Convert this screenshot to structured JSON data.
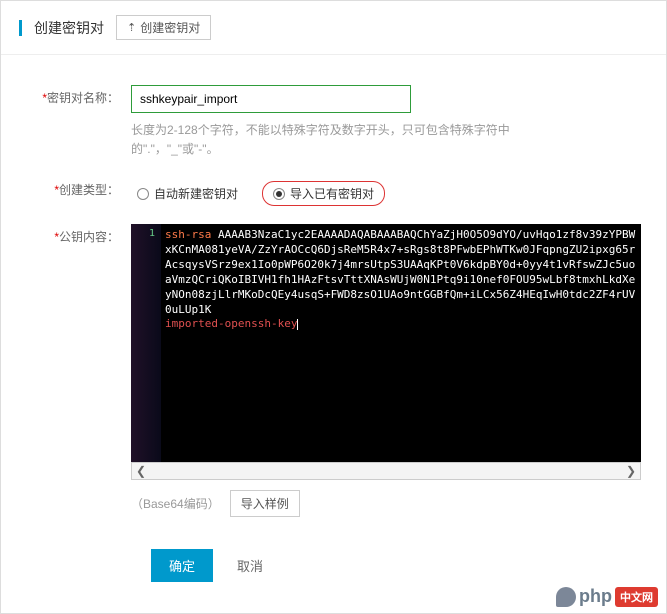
{
  "header": {
    "title": "创建密钥对",
    "upload_btn": "创建密钥对"
  },
  "labels": {
    "name": "密钥对名称：",
    "type": "创建类型：",
    "pubkey": "公钥内容："
  },
  "name_input": {
    "value": "sshkeypair_import",
    "hint": "长度为2-128个字符，不能以特殊字符及数字开头，只可包含特殊字符中的\".\"，\"_\"或\"-\"。"
  },
  "radios": {
    "auto": "自动新建密钥对",
    "import": "导入已有密钥对"
  },
  "code": {
    "gutter1": "1",
    "ssh": "ssh-rsa",
    "body": " AAAAB3NzaC1yc2EAAAADAQABAAABAQChYaZjH0O5O9dYO/uvHqo1zf8v39zYPBWxKCnMA081yeVA/ZzYrAOCcQ6DjsReM5R4x7+sRgs8t8PFwbEPhWTKw0JFqpngZU2ipxg65rAcsqysVSrz9ex1Io0pWP6O20k7j4mrsUtpS3UAAqKPt0V6kdpBY0d+0yy4t1vRfswZJc5uoaVmzQCriQKoIBIVH1fh1HAzFtsvTttXNAsWUjW0N1Ptq9i10nef0FOU95wLbf8tmxhLkdXeyNOn08zjLlrMKoDcQEy4usqS+FWD8zsO1UAo9ntGGBfQm+iLCx56Z4HEqIwH0tdc2ZF4rUV0uLUp1K",
    "imp": "imported-openssh-key"
  },
  "encoding": {
    "text": "（Base64编码）",
    "sample": "导入样例"
  },
  "actions": {
    "ok": "确定",
    "cancel": "取消"
  },
  "watermark": {
    "text": "php",
    "cn": "中文网"
  }
}
